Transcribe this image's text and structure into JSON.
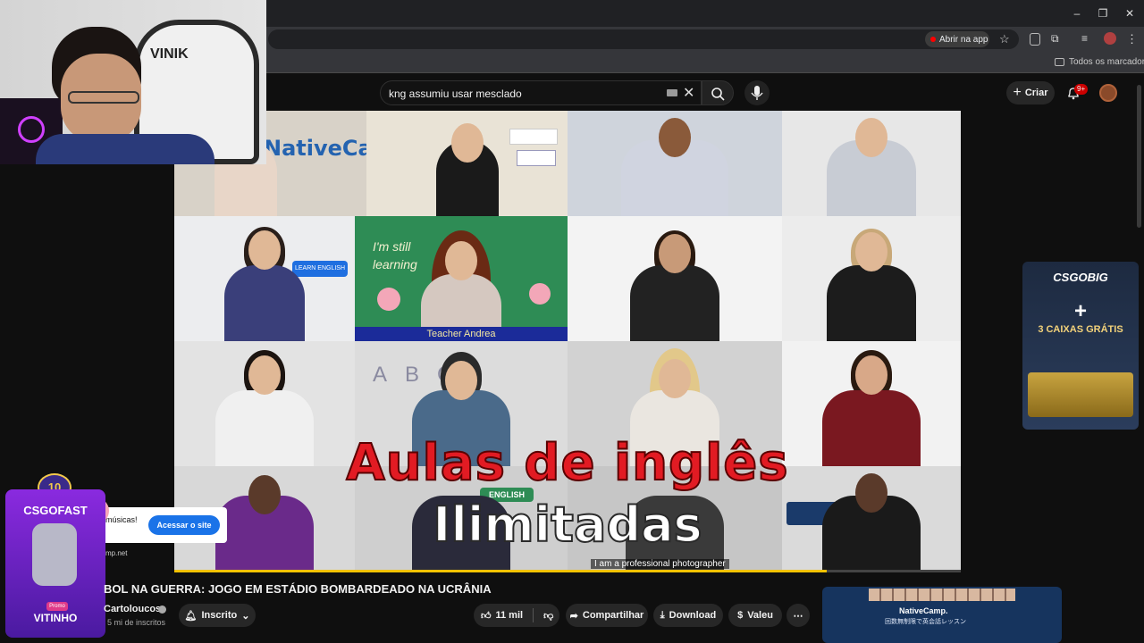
{
  "browser": {
    "open_app_label": "Abrir na app",
    "bookmarks_label": "Todos os marcadores",
    "window_controls": [
      "–",
      "❐",
      "✕"
    ]
  },
  "youtube": {
    "search_value": "kng assumiu usar mesclado",
    "create_label": "Criar",
    "notifications_badge": "9+"
  },
  "webcam": {
    "chair_brand": "VINIK"
  },
  "video": {
    "brand_text": "NativeCamp.",
    "tile_caption": "Teacher Andrea",
    "chalk_text": "I'm still learning",
    "sign_text": "LEARN ENGLISH",
    "badge_text": "ENGLISH",
    "subtitle_line": "I am a professional photographer",
    "overlay_line1": "Aulas de inglês",
    "overlay_line2": "Ilimitadas",
    "progress_fraction": 0.83
  },
  "ad_popup": {
    "text": "músicas!",
    "button": "Acessar o site",
    "url": "mp.net"
  },
  "csgobig": {
    "logo": "CSGOBIG",
    "plus": "+",
    "offer": "3 CAIXAS GRÁTIS"
  },
  "csgofast": {
    "badge": "10",
    "logo": "CSGOFAST",
    "promo": "Promo",
    "code": "VITINHO"
  },
  "video_info": {
    "title": "BOL NA GUERRA: JOGO EM ESTÁDIO BOMBARDEADO NA UCRÂNIA",
    "channel": "Cartoloucos",
    "subscribers": "5 mi de inscritos",
    "subscribed_label": "Inscrito",
    "likes": "11 mil",
    "share_label": "Compartilhar",
    "download_label": "Download",
    "thanks_label": "Valeu",
    "more": "⋯"
  },
  "sidebar_ad": {
    "brand": "NativeCamp.",
    "subtitle": "回数無制限で英会話レッスン"
  },
  "colors": {
    "overlay_red": "#e21b23",
    "youtube_red": "#ff0000",
    "blue_button": "#1a73e8",
    "progress": "#f2c200"
  }
}
